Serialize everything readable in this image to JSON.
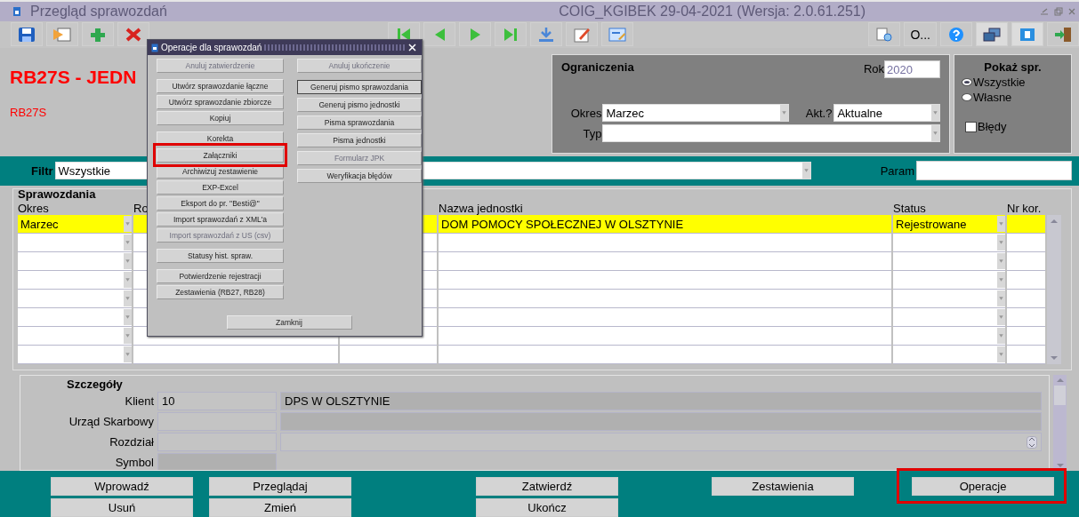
{
  "window": {
    "title": "Przegląd sprawozdań",
    "session": "COIG_KGIBEK  29-04-2021  (Wersja: 2.0.61.251)"
  },
  "toolbar": {
    "options_label": "O..."
  },
  "header": {
    "title": "RB27S - JEDN",
    "code": "RB27S"
  },
  "restrictions": {
    "title": "Ograniczenia",
    "year_label": "Rok",
    "year": "2020",
    "period_label": "Okres",
    "period": "Marzec",
    "current_label": "Akt.?",
    "current": "Aktualne",
    "type_label": "Typ"
  },
  "show": {
    "title": "Pokaż spr.",
    "options": [
      {
        "label": "Wszystkie",
        "selected": true
      },
      {
        "label": "Własne",
        "selected": false
      }
    ],
    "errors": {
      "label": "Błędy",
      "checked": false
    }
  },
  "filter": {
    "label": "Filtr",
    "value": "Wszystkie",
    "param_label": "Param"
  },
  "reports": {
    "title": "Sprawozdania",
    "columns": [
      {
        "label": "Okres",
        "dropdown": true
      },
      {
        "label": "Ro",
        "dropdown": false
      },
      {
        "dropdown": false
      },
      {
        "label": "Nazwa jednostki",
        "dropdown": false
      },
      {
        "label": "Status",
        "dropdown": true
      },
      {
        "label": "Nr kor.",
        "dropdown": false
      }
    ],
    "rows": [
      {
        "selected": true,
        "cells": [
          "Marzec",
          null,
          null,
          "DOM POMOCY SPOŁECZNEJ W OLSZTYNIE",
          "Rejestrowane",
          null
        ]
      },
      {
        "selected": false
      },
      {
        "selected": false
      },
      {
        "selected": false
      },
      {
        "selected": false
      },
      {
        "selected": false
      },
      {
        "selected": false
      },
      {
        "selected": false
      }
    ]
  },
  "details": {
    "title": "Szczegóły",
    "fields": [
      {
        "label": "Klient",
        "kind": "plain",
        "code": "10",
        "name": "DPS W OLSZTYNIE"
      },
      {
        "label": "Urząd Skarbowy",
        "kind": "plain"
      },
      {
        "label": "Rozdział",
        "kind": "spinner"
      },
      {
        "label": "Symbol",
        "kind": "short"
      }
    ]
  },
  "actions": [
    {
      "top": "Wprowadź",
      "bottom": "Usuń",
      "highlighted": false
    },
    {
      "top": "Przeglądaj",
      "bottom": "Zmień",
      "highlighted": false
    },
    {
      "top": "Zatwierdź",
      "bottom": "Ukończ",
      "highlighted": false
    },
    {
      "top": "Zestawienia",
      "highlighted": false
    },
    {
      "top": "Operacje",
      "highlighted": true
    }
  ],
  "dialog": {
    "title": "Operacje dla sprawozdań",
    "left": [
      [
        {
          "label": "Anuluj zatwierdzenie",
          "disabled": true,
          "highlighted": false
        }
      ],
      [
        {
          "label": "Utwórz sprawozdanie łączne",
          "disabled": false,
          "highlighted": false
        },
        {
          "label": "Utwórz sprawozdanie zbiorcze",
          "disabled": false,
          "highlighted": false
        },
        {
          "label": "Kopiuj",
          "disabled": false,
          "highlighted": false
        }
      ],
      [
        {
          "label": "Korekta",
          "disabled": false,
          "highlighted": false
        },
        {
          "label": "Załączniki",
          "disabled": false,
          "highlighted": true
        },
        {
          "label": "Archiwizuj zestawienie",
          "disabled": false,
          "highlighted": false
        },
        {
          "label": "EXP-Excel",
          "disabled": false,
          "highlighted": false
        },
        {
          "label": "Eksport do pr. \"Besti@\"",
          "disabled": false,
          "highlighted": false
        },
        {
          "label": "Import sprawozdań z XML'a",
          "disabled": false,
          "highlighted": false
        },
        {
          "label": "Import sprawozdań z US (csv)",
          "disabled": true,
          "highlighted": false
        }
      ],
      [
        {
          "label": "Statusy hist. spraw.",
          "disabled": false,
          "highlighted": false
        }
      ],
      [
        {
          "label": "Potwierdzenie rejestracji",
          "disabled": false,
          "highlighted": false
        },
        {
          "label": "Zestawienia (RB27, RB28)",
          "disabled": false,
          "highlighted": false
        }
      ]
    ],
    "right": [
      [
        {
          "label": "Anuluj ukończenie",
          "disabled": true,
          "focused": false
        }
      ],
      [
        {
          "label": "Generuj pismo sprawozdania",
          "disabled": false,
          "focused": true
        },
        {
          "label": "Generuj pismo jednostki",
          "disabled": false,
          "focused": false
        },
        {
          "label": "Pisma sprawozdania",
          "disabled": false,
          "focused": false
        },
        {
          "label": "Pisma jednostki",
          "disabled": false,
          "focused": false
        },
        {
          "label": "Formularz JPK",
          "disabled": true,
          "focused": false
        },
        {
          "label": "Weryfikacja błędów",
          "disabled": false,
          "focused": false
        }
      ]
    ],
    "close": "Zamknij"
  }
}
